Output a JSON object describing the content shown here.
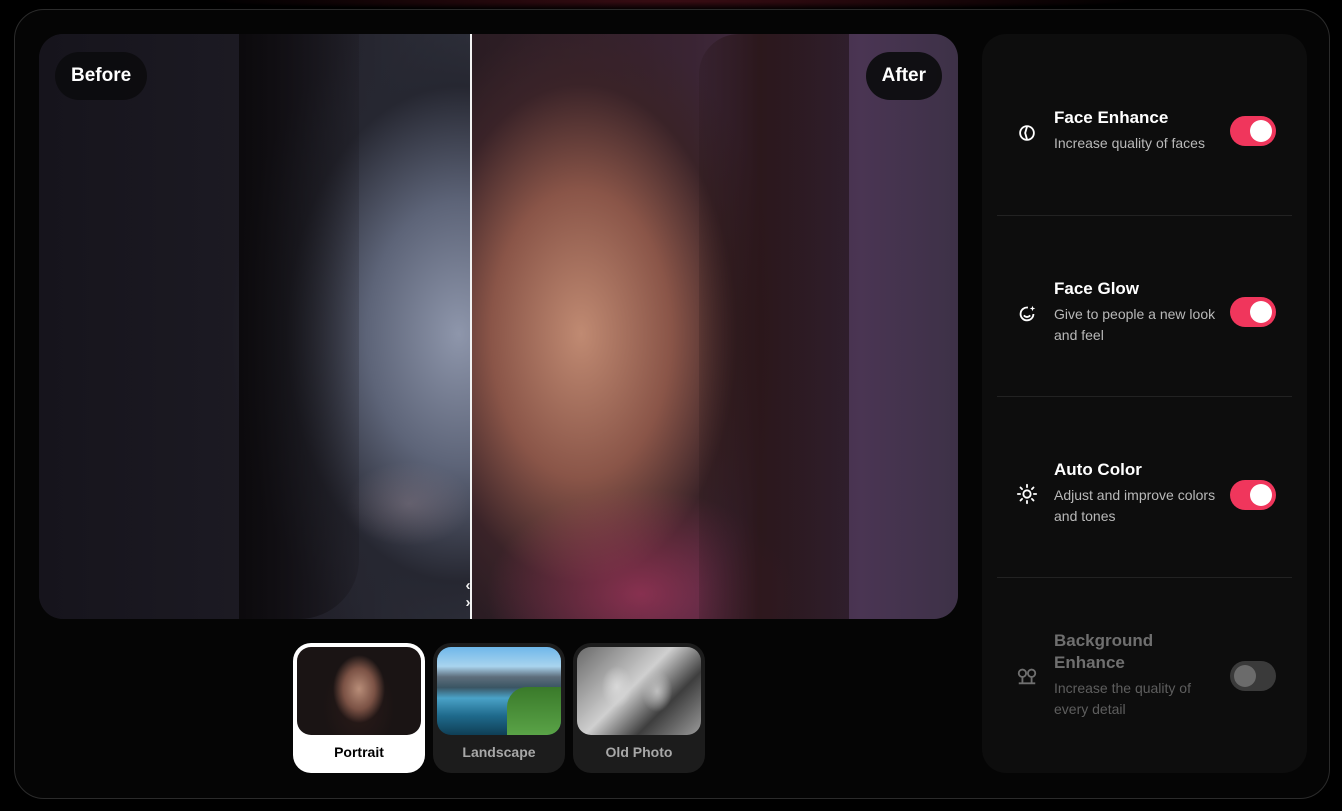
{
  "compare": {
    "before_label": "Before",
    "after_label": "After",
    "handle_glyph": "‹ ›",
    "split_fraction": 0.47
  },
  "presets": [
    {
      "label": "Portrait",
      "active": true,
      "icon": "portrait-thumbnail"
    },
    {
      "label": "Landscape",
      "active": false,
      "icon": "landscape-thumbnail"
    },
    {
      "label": "Old Photo",
      "active": false,
      "icon": "old-photo-thumbnail"
    }
  ],
  "options": [
    {
      "title": "Face Enhance",
      "description": "Increase quality of faces",
      "enabled": true,
      "icon": "face-enhance-icon"
    },
    {
      "title": "Face Glow",
      "description": "Give to people a new look and feel",
      "enabled": true,
      "icon": "face-glow-icon"
    },
    {
      "title": "Auto Color",
      "description": "Adjust and improve colors and tones",
      "enabled": true,
      "icon": "sun-icon"
    },
    {
      "title": "Background Enhance",
      "description": "Increase the quality of every detail",
      "enabled": false,
      "icon": "background-enhance-icon"
    }
  ],
  "colors": {
    "accent": "#f0365c",
    "panel": "#0d0d0d",
    "background": "#000000"
  }
}
